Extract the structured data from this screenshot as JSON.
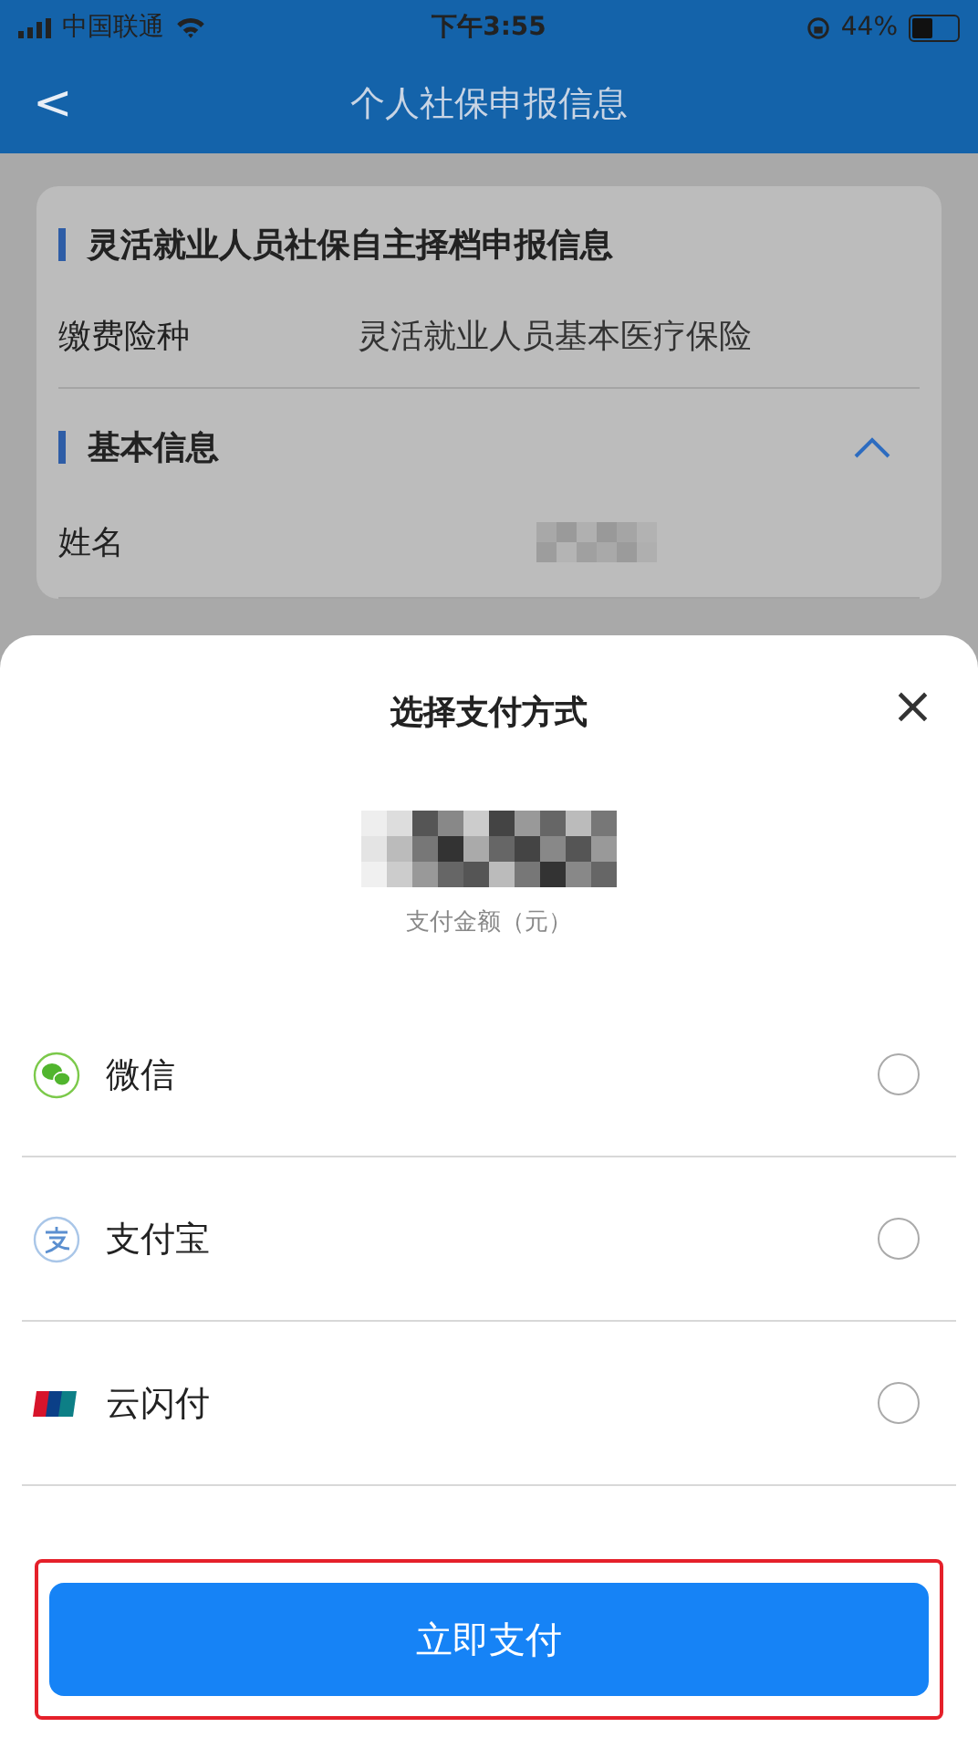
{
  "status_bar": {
    "carrier": "中国联通",
    "time": "下午3:55",
    "battery_percent": "44%"
  },
  "nav": {
    "back": "<",
    "title": "个人社保申报信息"
  },
  "card": {
    "section_title": "灵活就业人员社保自主择档申报信息",
    "fields": [
      {
        "label": "缴费险种",
        "value": "灵活就业人员基本医疗保险"
      }
    ],
    "basic_section": {
      "title": "基本信息",
      "expanded": true,
      "fields": [
        {
          "label": "姓名"
        }
      ]
    }
  },
  "sheet": {
    "title": "选择支付方式",
    "close": "×",
    "amount_caption": "支付金额（元）",
    "methods": [
      {
        "kind": "wechat",
        "label": "微信",
        "selected": false
      },
      {
        "kind": "alipay",
        "label": "支付宝",
        "selected": false
      },
      {
        "kind": "unionpay",
        "label": "云闪付",
        "selected": false
      }
    ],
    "pay_button": {
      "label": "立即支付",
      "highlighted": true
    }
  }
}
